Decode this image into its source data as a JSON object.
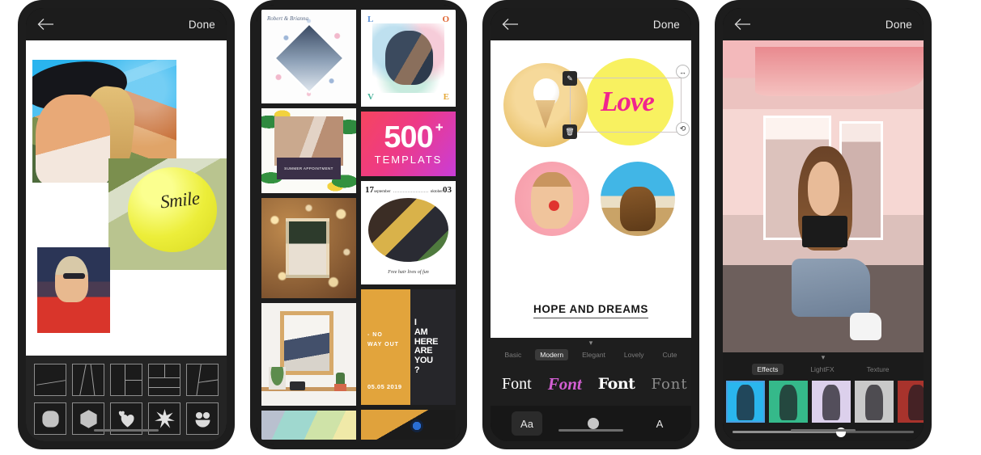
{
  "app": {
    "nav": {
      "back_icon": "back-arrow-icon",
      "done_label": "Done"
    }
  },
  "phone1": {
    "name": "collage-editor",
    "canvas": {
      "photos": [
        {
          "id": "photo-hat-desert",
          "alt": "woman in black hat"
        },
        {
          "id": "photo-smile-balloon",
          "alt": "yellow balloon",
          "text": "Smile"
        },
        {
          "id": "photo-red-shirt",
          "alt": "woman in red shirt"
        }
      ]
    },
    "layouts": [
      {
        "name": "layout-two-diagonal"
      },
      {
        "name": "layout-two-slanted"
      },
      {
        "name": "layout-three-split"
      },
      {
        "name": "layout-four-grid"
      },
      {
        "name": "layout-three-angled"
      }
    ],
    "shapes": [
      {
        "name": "shape-rounded-square"
      },
      {
        "name": "shape-hexagon"
      },
      {
        "name": "shape-heart"
      },
      {
        "name": "shape-splat"
      },
      {
        "name": "shape-smiley"
      }
    ]
  },
  "phone2": {
    "name": "template-gallery",
    "templates": [
      {
        "id": "wedding-invite",
        "names": "Robert\n& Brianna"
      },
      {
        "id": "love-watercolor",
        "letters": [
          "L",
          "O",
          "V",
          "E"
        ]
      },
      {
        "id": "summer-tropical",
        "caption": "SUMMER APPOINTMENT"
      },
      {
        "id": "templates-count",
        "count": "500",
        "plus": "+",
        "label": "TEMPLATS"
      },
      {
        "id": "bokeh-frame"
      },
      {
        "id": "calendar-story",
        "day": "17",
        "month": "september",
        "month2": "oktober",
        "day2": "03",
        "caption": "Free hair lives of fun"
      },
      {
        "id": "room-frame"
      },
      {
        "id": "no-way-out",
        "line1": "- NO",
        "line2": "WAY OUT",
        "date": "05.05 2019",
        "right": [
          "I",
          "AM",
          "HERE",
          "ARE",
          "YOU",
          "?"
        ]
      },
      {
        "id": "pastel-abstract"
      },
      {
        "id": "dog-portrait"
      }
    ]
  },
  "phone3": {
    "name": "text-font-editor",
    "canvas": {
      "sticker_text": "Love",
      "title_text": "HOPE AND DREAMS",
      "handles": [
        {
          "name": "edit-handle",
          "glyph": "✎"
        },
        {
          "name": "delete-handle",
          "glyph": "🗑"
        },
        {
          "name": "resize-handle",
          "glyph": "↔"
        },
        {
          "name": "rotate-handle",
          "glyph": "⟲"
        }
      ]
    },
    "categories": [
      {
        "label": "Basic",
        "active": false
      },
      {
        "label": "Modern",
        "active": true
      },
      {
        "label": "Elegant",
        "active": false
      },
      {
        "label": "Lovely",
        "active": false
      },
      {
        "label": "Cute",
        "active": false
      }
    ],
    "fonts": [
      {
        "label": "Font",
        "style": "script-light"
      },
      {
        "label": "Font",
        "style": "script-pink"
      },
      {
        "label": "Font",
        "style": "bold-serif"
      },
      {
        "label": "Font",
        "style": "outline"
      }
    ],
    "toolbar": [
      {
        "label": "Aa",
        "name": "font-tool",
        "active": true
      },
      {
        "label": "",
        "name": "color-tool",
        "active": false
      },
      {
        "label": "A",
        "name": "style-tool",
        "active": false
      }
    ],
    "collapse_icon": "chevron-down-icon"
  },
  "phone4": {
    "name": "effects-editor",
    "tabs": [
      {
        "label": "Effects",
        "active": true
      },
      {
        "label": "LightFX",
        "active": false
      },
      {
        "label": "Texture",
        "active": false
      }
    ],
    "filters": [
      {
        "name": "filter-cyan",
        "color": "#2ab6ee",
        "selected": true
      },
      {
        "name": "filter-green",
        "color": "#35b98a",
        "selected": false
      },
      {
        "name": "filter-lavender",
        "color": "#dcd0ec",
        "selected": false
      },
      {
        "name": "filter-grey",
        "color": "#c9c9c9",
        "selected": false
      },
      {
        "name": "filter-red",
        "color": "#a8332c",
        "selected": false
      },
      {
        "name": "filter-yellow",
        "color": "#d7d338",
        "selected": false
      }
    ],
    "slider": {
      "name": "intensity-slider",
      "value": 60
    },
    "collapse_icon": "chevron-down-icon"
  }
}
